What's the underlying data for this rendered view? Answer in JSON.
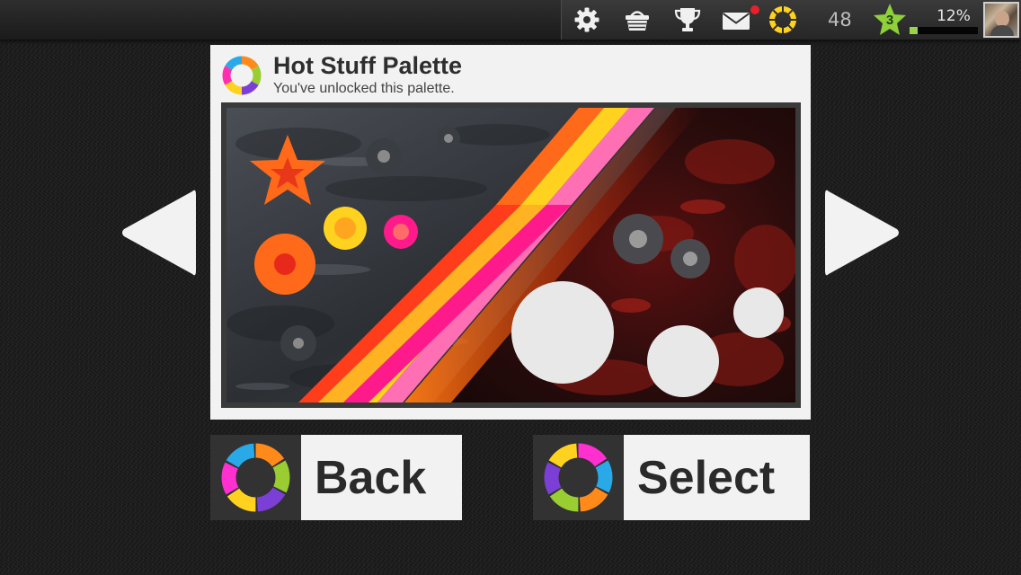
{
  "hud": {
    "icons": [
      "gear-icon",
      "basket-icon",
      "trophy-icon",
      "mail-icon",
      "palette-ring-icon"
    ],
    "coins": "48",
    "level": "3",
    "xp_percent_label": "12%",
    "xp_fraction": 0.12
  },
  "palette": {
    "title": "Hot Stuff Palette",
    "subtitle": "You've unlocked this palette.",
    "colors": [
      "#ff6a1a",
      "#ffb222",
      "#ff1a8c",
      "#ffd21f",
      "#ff3d1a",
      "#e8e8e8"
    ]
  },
  "buttons": {
    "back_label": "Back",
    "select_label": "Select"
  },
  "colors": {
    "background": "#1c1c1c",
    "panel": "#f2f2f2",
    "level_star": "#8fd13a",
    "notification": "#e8202a"
  }
}
